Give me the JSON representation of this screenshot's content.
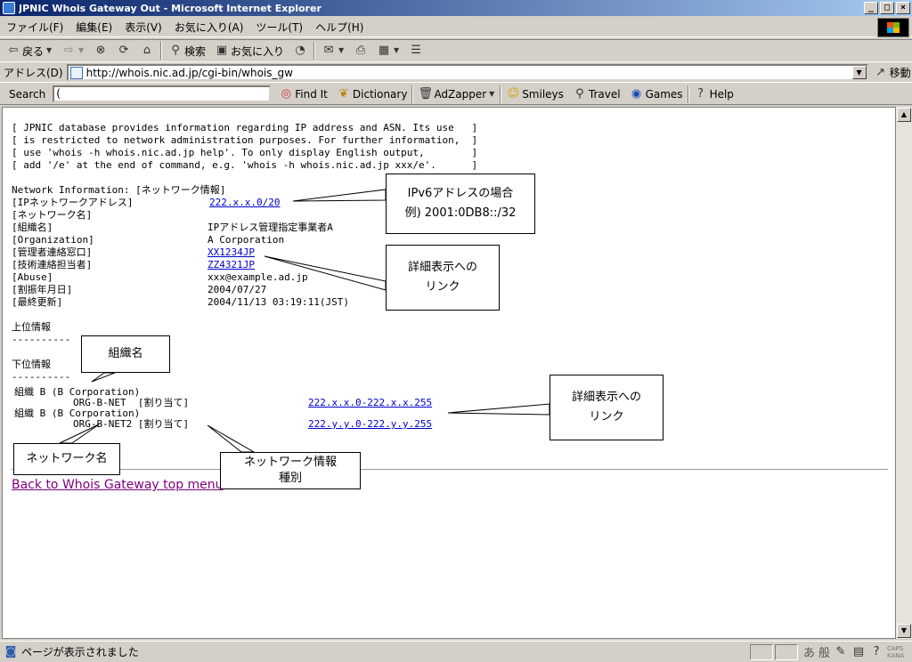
{
  "window": {
    "title": "JPNIC Whois Gateway Out - Microsoft Internet Explorer",
    "min": "_",
    "max": "□",
    "close": "×"
  },
  "menu": [
    "ファイル(F)",
    "編集(E)",
    "表示(V)",
    "お気に入り(A)",
    "ツール(T)",
    "ヘルプ(H)"
  ],
  "toolbar": {
    "back": "戻る",
    "search": "検索",
    "favorites": "お気に入り"
  },
  "address": {
    "label": "アドレス(D)",
    "url": "http://whois.nic.ad.jp/cgi-bin/whois_gw",
    "go": "移動"
  },
  "links": {
    "search_label": "Search",
    "search_value": "(",
    "items": [
      "Find It",
      "Dictionary",
      "AdZapper",
      "Smileys",
      "Travel",
      "Games",
      "Help"
    ]
  },
  "page": {
    "notice": [
      "[ JPNIC database provides information regarding IP address and ASN. Its use   ]",
      "[ is restricted to network administration purposes. For further information,  ]",
      "[ use 'whois -h whois.nic.ad.jp help'. To only display English output,        ]",
      "[ add '/e' at the end of command, e.g. 'whois -h whois.nic.ad.jp xxx/e'.      ]"
    ],
    "network_heading": "Network Information: [ネットワーク情報]",
    "fields": [
      {
        "label": "[IPネットワークアドレス]",
        "value": "222.x.x.0/20",
        "link": true
      },
      {
        "label": "[ネットワーク名]",
        "value": "",
        "link": false
      },
      {
        "label": "[組織名]",
        "value": "IPアドレス管理指定事業者A",
        "link": false
      },
      {
        "label": "[Organization]",
        "value": "A Corporation",
        "link": false
      },
      {
        "label": "[管理者連絡窓口]",
        "value": "XX1234JP",
        "link": true
      },
      {
        "label": "[技術連絡担当者]",
        "value": "ZZ4321JP",
        "link": true
      },
      {
        "label": "[Abuse]",
        "value": "xxx@example.ad.jp",
        "link": false
      },
      {
        "label": "[割振年月日]",
        "value": "2004/07/27",
        "link": false
      },
      {
        "label": "[最終更新]",
        "value": "2004/11/13 03:19:11(JST)",
        "link": false
      }
    ],
    "upper_heading": "上位情報",
    "lower_heading": "下位情報",
    "dashes": "----------",
    "sub_networks": [
      {
        "org": "組織 B (B Corporation)",
        "net": "ORG-B-NET  [割り当て]",
        "range": "222.x.x.0-222.x.x.255"
      },
      {
        "org": "組織 B (B Corporation)",
        "net": "ORG-B-NET2 [割り当て]",
        "range": "222.y.y.0-222.y.y.255"
      }
    ],
    "back_link": "Back to Whois Gateway top menu"
  },
  "callouts": {
    "ipv6": [
      "IPv6アドレスの場合",
      "例) 2001:0DB8::/32"
    ],
    "detail_link_1": [
      "詳細表示への",
      "リンク"
    ],
    "org_name": "組織名",
    "detail_link_2": [
      "詳細表示への",
      "リンク"
    ],
    "network_name": "ネットワーク名",
    "network_type": [
      "ネットワーク情報",
      "種別"
    ]
  },
  "status": {
    "text": "ページが表示されました",
    "ime": [
      "あ",
      "般"
    ],
    "caps": "CAPS",
    "kana": "KANA"
  }
}
